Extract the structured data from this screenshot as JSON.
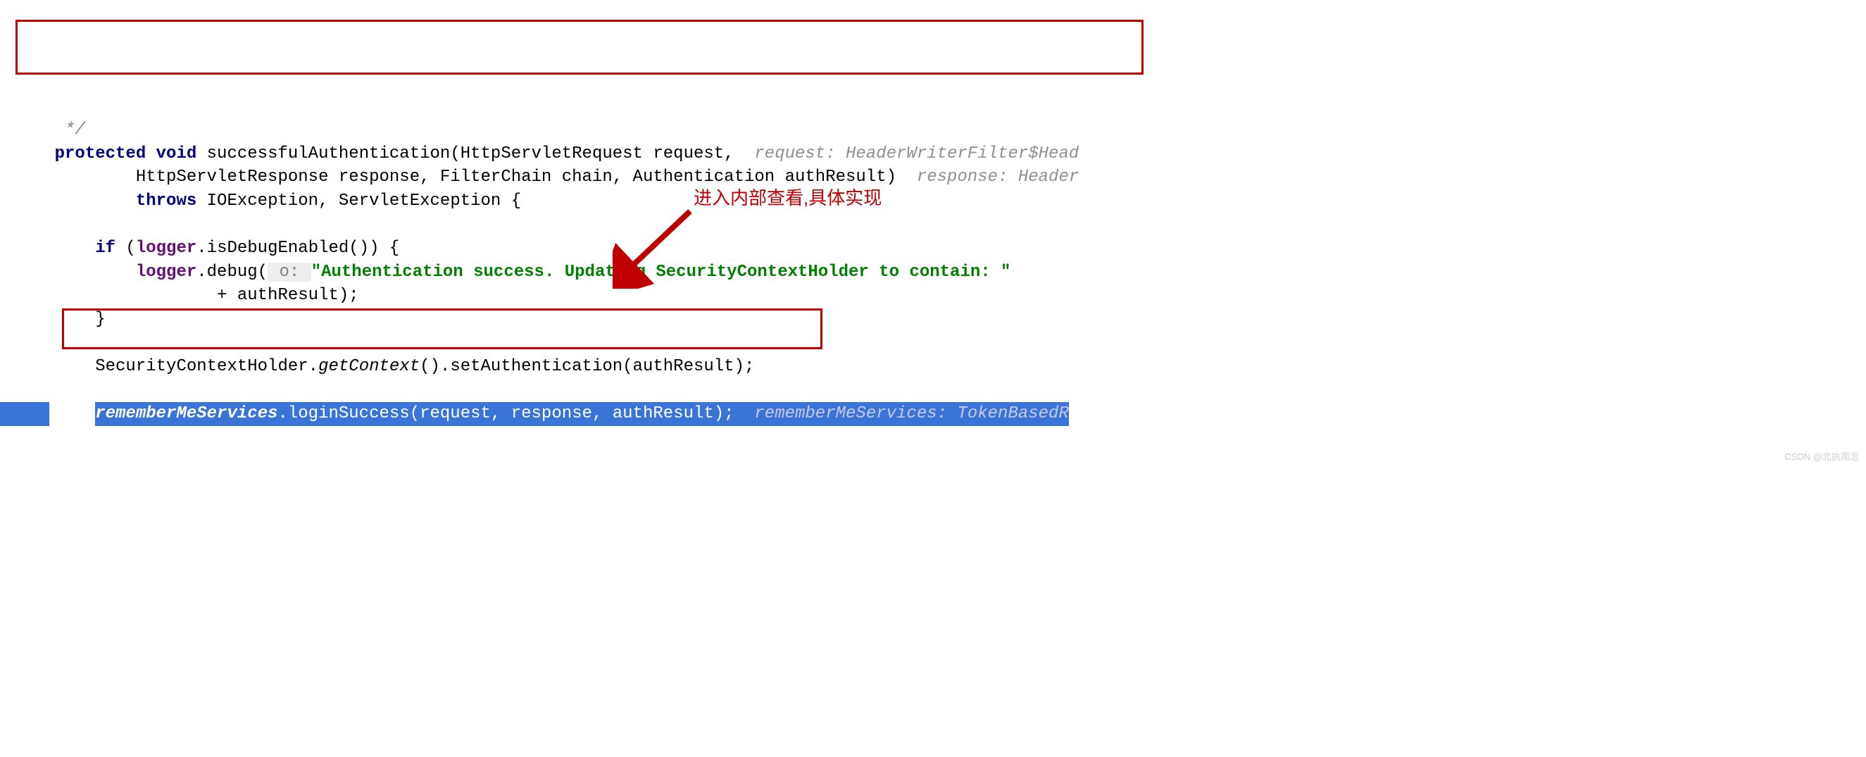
{
  "code": {
    "comment_end": "     */",
    "line1_kw_protected": "protected",
    "line1_kw_void": "void",
    "line1_method": "successfulAuthentication(HttpServletRequest request,",
    "line1_hint": "request: HeaderWriterFilter$Head",
    "line2_body": "            HttpServletResponse response, FilterChain chain, Authentication authResult)",
    "line2_hint": "response: Header",
    "line3_kw_throws": "throws",
    "line3_rest": "IOException, ServletException {",
    "line5_kw_if": "if",
    "line5_open": " (",
    "line5_field": "logger",
    "line5_rest": ".isDebugEnabled()) {",
    "line6_field": "logger",
    "line6_call": ".debug(",
    "line6_paramhint": " o: ",
    "line6_str": "\"Authentication success. Updating SecurityContextHolder to contain: \"",
    "line7_body": "                    + authResult);",
    "line8_body": "        }",
    "line10_body": "        SecurityContextHolder.",
    "line10_italic": "getContext",
    "line10_rest": "().setAuthentication(authResult);",
    "line12_field": "rememberMeServices",
    "line12_rest": ".loginSuccess(request, response, authResult);",
    "line12_hint": " rememberMeServices: TokenBasedR"
  },
  "annotation": {
    "text": "进入内部查看,具体实现"
  },
  "watermark": "CSDN @北执南念"
}
